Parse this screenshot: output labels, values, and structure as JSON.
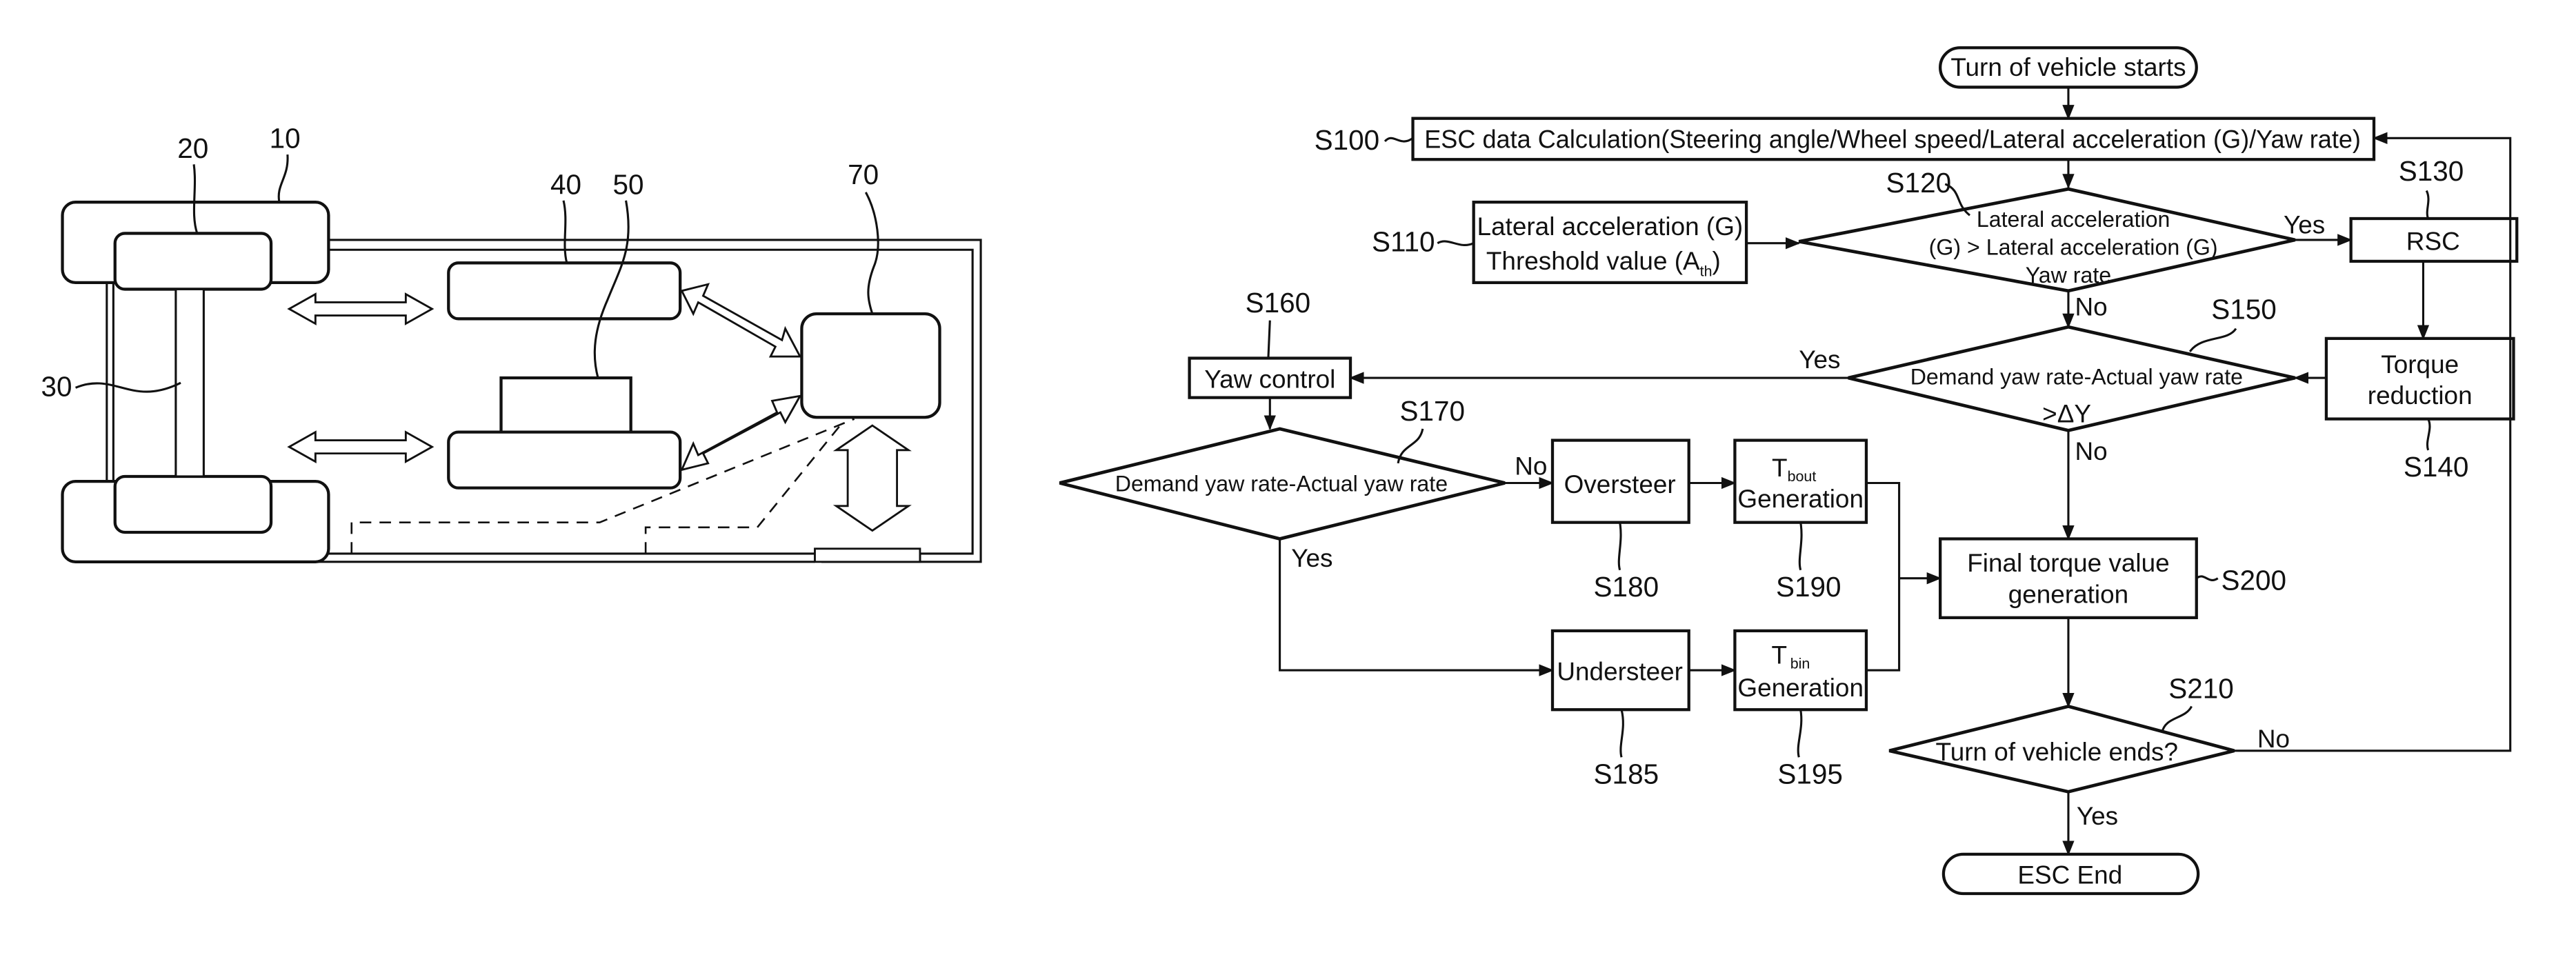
{
  "left_diagram": {
    "refs": [
      "10",
      "20",
      "30",
      "40",
      "50",
      "70"
    ]
  },
  "flowchart": {
    "start": "Turn of vehicle starts",
    "s100": {
      "ref": "S100",
      "label": "ESC data Calculation(Steering angle/Wheel speed/Lateral acceleration (G)/Yaw rate)"
    },
    "s110": {
      "ref": "S110",
      "line1": "Lateral acceleration (G)",
      "line2_pre": "Threshold value (A",
      "line2_sub": "th",
      "line2_post": ")"
    },
    "s120": {
      "ref": "S120",
      "line1": "Lateral acceleration",
      "line2": "(G) > Lateral acceleration (G)",
      "line3": "Yaw rate",
      "yes": "Yes",
      "no": "No"
    },
    "s130": {
      "ref": "S130",
      "label": "RSC"
    },
    "s140": {
      "ref": "S140",
      "line1": "Torque",
      "line2": "reduction"
    },
    "s150": {
      "ref": "S150",
      "line1": "Demand yaw rate-Actual yaw rate",
      "line2": ">ΔY",
      "yes": "Yes",
      "no": "No"
    },
    "s160": {
      "ref": "S160",
      "label": "Yaw control"
    },
    "s170": {
      "ref": "S170",
      "label": "Demand yaw rate-Actual yaw rate",
      "yes": "Yes",
      "no": "No"
    },
    "s180": {
      "ref": "S180",
      "label": "Oversteer"
    },
    "s185": {
      "ref": "S185",
      "label": "Understeer"
    },
    "s190": {
      "ref": "S190",
      "t": "T",
      "sub": "bout",
      "line2": "Generation"
    },
    "s195": {
      "ref": "S195",
      "t": "T",
      "sub": "bin",
      "line2": "Generation"
    },
    "s200": {
      "ref": "S200",
      "line1": "Final torque value",
      "line2": "generation"
    },
    "s210": {
      "ref": "S210",
      "label": "Turn of vehicle ends?",
      "yes": "Yes",
      "no": "No"
    },
    "end": "ESC End"
  }
}
